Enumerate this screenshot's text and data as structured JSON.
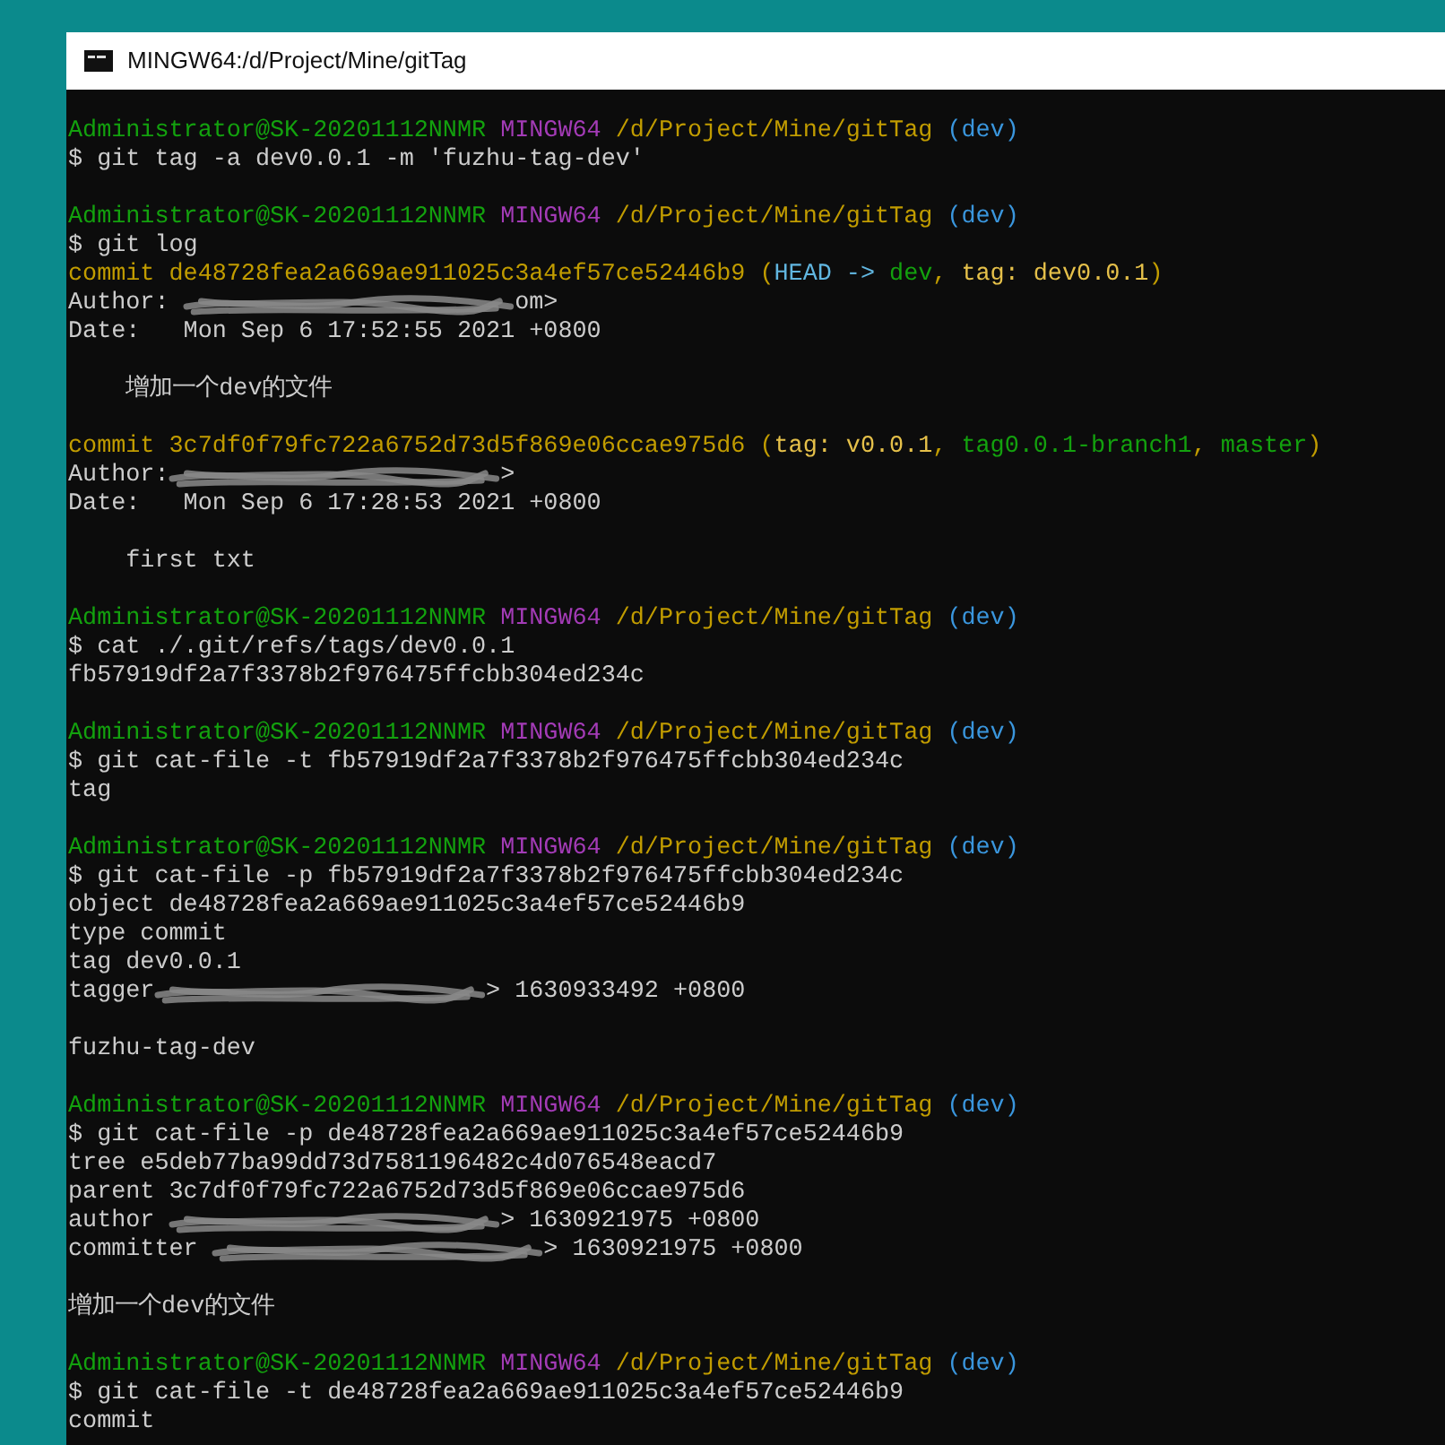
{
  "window": {
    "title": "MINGW64:/d/Project/Mine/gitTag"
  },
  "terminal": {
    "lines": [
      {
        "kind": "text",
        "spans": [
          {
            "kind": "text",
            "text": "Administrator@SK-20201112NNMR",
            "color": "#13a10e"
          },
          {
            "kind": "space"
          },
          {
            "kind": "text",
            "text": "MINGW64",
            "color": "#a33bb6"
          },
          {
            "kind": "space"
          },
          {
            "kind": "text",
            "text": "/d/Project/Mine/gitTag",
            "color": "#c19c00"
          },
          {
            "kind": "space"
          },
          {
            "kind": "text",
            "text": "(dev)",
            "color": "#3a96dd"
          }
        ]
      },
      {
        "kind": "text",
        "spans": [
          {
            "kind": "text",
            "text": "$ git tag -a dev0.0.1 -m 'fuzhu-tag-dev'",
            "color": "#cccccc"
          }
        ]
      },
      {
        "kind": "blank"
      },
      {
        "kind": "text",
        "spans": [
          {
            "kind": "text",
            "text": "Administrator@SK-20201112NNMR",
            "color": "#13a10e"
          },
          {
            "kind": "space"
          },
          {
            "kind": "text",
            "text": "MINGW64",
            "color": "#a33bb6"
          },
          {
            "kind": "space"
          },
          {
            "kind": "text",
            "text": "/d/Project/Mine/gitTag",
            "color": "#c19c00"
          },
          {
            "kind": "space"
          },
          {
            "kind": "text",
            "text": "(dev)",
            "color": "#3a96dd"
          }
        ]
      },
      {
        "kind": "text",
        "spans": [
          {
            "kind": "text",
            "text": "$ git log",
            "color": "#cccccc"
          }
        ]
      },
      {
        "kind": "text",
        "spans": [
          {
            "kind": "text",
            "text": "commit de48728fea2a669ae911025c3a4ef57ce52446b9 (",
            "color": "#c19c00"
          },
          {
            "kind": "text",
            "text": "HEAD ->",
            "color": "#61b6e0"
          },
          {
            "kind": "space"
          },
          {
            "kind": "text",
            "text": "dev",
            "color": "#13a10e"
          },
          {
            "kind": "text",
            "text": ",",
            "color": "#c19c00"
          },
          {
            "kind": "space"
          },
          {
            "kind": "text",
            "text": "tag: dev0.0.1",
            "color": "#e5c04a"
          },
          {
            "kind": "text",
            "text": ")",
            "color": "#c19c00"
          }
        ]
      },
      {
        "kind": "text",
        "spans": [
          {
            "kind": "text",
            "text": "Author: ",
            "color": "#cccccc"
          },
          {
            "kind": "redaction"
          },
          {
            "kind": "text",
            "text": "om>",
            "color": "#cccccc"
          }
        ]
      },
      {
        "kind": "text",
        "spans": [
          {
            "kind": "text",
            "text": "Date:   Mon Sep 6 17:52:55 2021 +0800",
            "color": "#cccccc"
          }
        ]
      },
      {
        "kind": "blank"
      },
      {
        "kind": "text",
        "spans": [
          {
            "kind": "text",
            "text": "    增加一个dev的文件",
            "color": "#cccccc"
          }
        ]
      },
      {
        "kind": "blank"
      },
      {
        "kind": "text",
        "spans": [
          {
            "kind": "text",
            "text": "commit 3c7df0f79fc722a6752d73d5f869e06ccae975d6 (",
            "color": "#c19c00"
          },
          {
            "kind": "text",
            "text": "tag: v0.0.1",
            "color": "#e5c04a"
          },
          {
            "kind": "text",
            "text": ",",
            "color": "#c19c00"
          },
          {
            "kind": "space"
          },
          {
            "kind": "text",
            "text": "tag0.0.1-branch1",
            "color": "#13a10e"
          },
          {
            "kind": "text",
            "text": ",",
            "color": "#c19c00"
          },
          {
            "kind": "space"
          },
          {
            "kind": "text",
            "text": "master",
            "color": "#13a10e"
          },
          {
            "kind": "text",
            "text": ")",
            "color": "#c19c00"
          }
        ]
      },
      {
        "kind": "text",
        "spans": [
          {
            "kind": "text",
            "text": "Author:",
            "color": "#cccccc"
          },
          {
            "kind": "redaction"
          },
          {
            "kind": "text",
            "text": ">",
            "color": "#cccccc"
          }
        ]
      },
      {
        "kind": "text",
        "spans": [
          {
            "kind": "text",
            "text": "Date:   Mon Sep 6 17:28:53 2021 +0800",
            "color": "#cccccc"
          }
        ]
      },
      {
        "kind": "blank"
      },
      {
        "kind": "text",
        "spans": [
          {
            "kind": "text",
            "text": "    first txt",
            "color": "#cccccc"
          }
        ]
      },
      {
        "kind": "blank"
      },
      {
        "kind": "text",
        "spans": [
          {
            "kind": "text",
            "text": "Administrator@SK-20201112NNMR",
            "color": "#13a10e"
          },
          {
            "kind": "space"
          },
          {
            "kind": "text",
            "text": "MINGW64",
            "color": "#a33bb6"
          },
          {
            "kind": "space"
          },
          {
            "kind": "text",
            "text": "/d/Project/Mine/gitTag",
            "color": "#c19c00"
          },
          {
            "kind": "space"
          },
          {
            "kind": "text",
            "text": "(dev)",
            "color": "#3a96dd"
          }
        ]
      },
      {
        "kind": "text",
        "spans": [
          {
            "kind": "text",
            "text": "$ cat ./.git/refs/tags/dev0.0.1",
            "color": "#cccccc"
          }
        ]
      },
      {
        "kind": "text",
        "spans": [
          {
            "kind": "text",
            "text": "fb57919df2a7f3378b2f976475ffcbb304ed234c",
            "color": "#cccccc"
          }
        ]
      },
      {
        "kind": "blank"
      },
      {
        "kind": "text",
        "spans": [
          {
            "kind": "text",
            "text": "Administrator@SK-20201112NNMR",
            "color": "#13a10e"
          },
          {
            "kind": "space"
          },
          {
            "kind": "text",
            "text": "MINGW64",
            "color": "#a33bb6"
          },
          {
            "kind": "space"
          },
          {
            "kind": "text",
            "text": "/d/Project/Mine/gitTag",
            "color": "#c19c00"
          },
          {
            "kind": "space"
          },
          {
            "kind": "text",
            "text": "(dev)",
            "color": "#3a96dd"
          }
        ]
      },
      {
        "kind": "text",
        "spans": [
          {
            "kind": "text",
            "text": "$ git cat-file -t fb57919df2a7f3378b2f976475ffcbb304ed234c",
            "color": "#cccccc"
          }
        ]
      },
      {
        "kind": "text",
        "spans": [
          {
            "kind": "text",
            "text": "tag",
            "color": "#cccccc"
          }
        ]
      },
      {
        "kind": "blank"
      },
      {
        "kind": "text",
        "spans": [
          {
            "kind": "text",
            "text": "Administrator@SK-20201112NNMR",
            "color": "#13a10e"
          },
          {
            "kind": "space"
          },
          {
            "kind": "text",
            "text": "MINGW64",
            "color": "#a33bb6"
          },
          {
            "kind": "space"
          },
          {
            "kind": "text",
            "text": "/d/Project/Mine/gitTag",
            "color": "#c19c00"
          },
          {
            "kind": "space"
          },
          {
            "kind": "text",
            "text": "(dev)",
            "color": "#3a96dd"
          }
        ]
      },
      {
        "kind": "text",
        "spans": [
          {
            "kind": "text",
            "text": "$ git cat-file -p fb57919df2a7f3378b2f976475ffcbb304ed234c",
            "color": "#cccccc"
          }
        ]
      },
      {
        "kind": "text",
        "spans": [
          {
            "kind": "text",
            "text": "object de48728fea2a669ae911025c3a4ef57ce52446b9",
            "color": "#cccccc"
          }
        ]
      },
      {
        "kind": "text",
        "spans": [
          {
            "kind": "text",
            "text": "type commit",
            "color": "#cccccc"
          }
        ]
      },
      {
        "kind": "text",
        "spans": [
          {
            "kind": "text",
            "text": "tag dev0.0.1",
            "color": "#cccccc"
          }
        ]
      },
      {
        "kind": "text",
        "spans": [
          {
            "kind": "text",
            "text": "tagger",
            "color": "#cccccc"
          },
          {
            "kind": "redaction"
          },
          {
            "kind": "text",
            "text": "> 1630933492 +0800",
            "color": "#cccccc"
          }
        ]
      },
      {
        "kind": "blank"
      },
      {
        "kind": "text",
        "spans": [
          {
            "kind": "text",
            "text": "fuzhu-tag-dev",
            "color": "#cccccc"
          }
        ]
      },
      {
        "kind": "blank"
      },
      {
        "kind": "text",
        "spans": [
          {
            "kind": "text",
            "text": "Administrator@SK-20201112NNMR",
            "color": "#13a10e"
          },
          {
            "kind": "space"
          },
          {
            "kind": "text",
            "text": "MINGW64",
            "color": "#a33bb6"
          },
          {
            "kind": "space"
          },
          {
            "kind": "text",
            "text": "/d/Project/Mine/gitTag",
            "color": "#c19c00"
          },
          {
            "kind": "space"
          },
          {
            "kind": "text",
            "text": "(dev)",
            "color": "#3a96dd"
          }
        ]
      },
      {
        "kind": "text",
        "spans": [
          {
            "kind": "text",
            "text": "$ git cat-file -p de48728fea2a669ae911025c3a4ef57ce52446b9",
            "color": "#cccccc"
          }
        ]
      },
      {
        "kind": "text",
        "spans": [
          {
            "kind": "text",
            "text": "tree e5deb77ba99dd73d7581196482c4d076548eacd7",
            "color": "#cccccc"
          }
        ]
      },
      {
        "kind": "text",
        "spans": [
          {
            "kind": "text",
            "text": "parent 3c7df0f79fc722a6752d73d5f869e06ccae975d6",
            "color": "#cccccc"
          }
        ]
      },
      {
        "kind": "text",
        "spans": [
          {
            "kind": "text",
            "text": "author ",
            "color": "#cccccc"
          },
          {
            "kind": "redaction"
          },
          {
            "kind": "text",
            "text": "> 1630921975 +0800",
            "color": "#cccccc"
          }
        ]
      },
      {
        "kind": "text",
        "spans": [
          {
            "kind": "text",
            "text": "committer ",
            "color": "#cccccc"
          },
          {
            "kind": "redaction"
          },
          {
            "kind": "text",
            "text": "> 1630921975 +0800",
            "color": "#cccccc"
          }
        ]
      },
      {
        "kind": "blank"
      },
      {
        "kind": "text",
        "spans": [
          {
            "kind": "text",
            "text": "增加一个dev的文件",
            "color": "#cccccc"
          }
        ]
      },
      {
        "kind": "blank"
      },
      {
        "kind": "text",
        "spans": [
          {
            "kind": "text",
            "text": "Administrator@SK-20201112NNMR",
            "color": "#13a10e"
          },
          {
            "kind": "space"
          },
          {
            "kind": "text",
            "text": "MINGW64",
            "color": "#a33bb6"
          },
          {
            "kind": "space"
          },
          {
            "kind": "text",
            "text": "/d/Project/Mine/gitTag",
            "color": "#c19c00"
          },
          {
            "kind": "space"
          },
          {
            "kind": "text",
            "text": "(dev)",
            "color": "#3a96dd"
          }
        ]
      },
      {
        "kind": "text",
        "spans": [
          {
            "kind": "text",
            "text": "$ git cat-file -t de48728fea2a669ae911025c3a4ef57ce52446b9",
            "color": "#cccccc"
          }
        ]
      },
      {
        "kind": "text",
        "spans": [
          {
            "kind": "text",
            "text": "commit",
            "color": "#cccccc"
          }
        ]
      }
    ]
  }
}
